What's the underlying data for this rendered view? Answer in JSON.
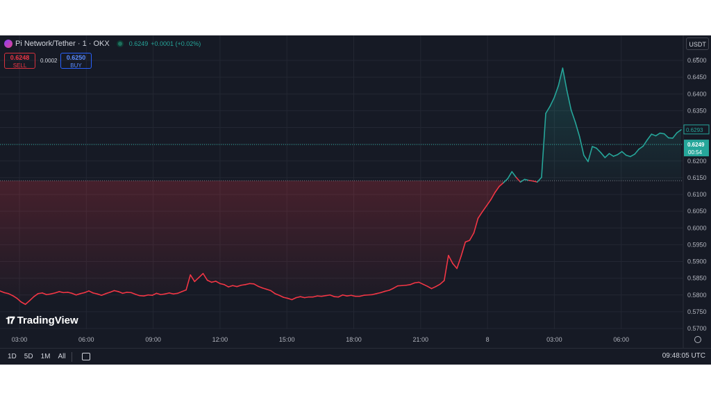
{
  "header": {
    "symbol": "Pi Network/Tether · 1 · OKX",
    "last": "0.6249",
    "change": "+0.0001 (+0.02%)"
  },
  "orders": {
    "sell_price": "0.6248",
    "sell_label": "SELL",
    "spread": "0.0002",
    "buy_price": "0.6250",
    "buy_label": "BUY"
  },
  "currency": "USDT",
  "logo": "TradingView",
  "ranges": [
    "1D",
    "5D",
    "1M",
    "All"
  ],
  "clock": "09:48:05 UTC",
  "price_labels": {
    "current": "0.6249",
    "countdown": "00:54",
    "reference": "0.6293"
  },
  "colors": {
    "up": "#26a69a",
    "down": "#f23645",
    "background": "#161a25"
  },
  "chart_data": {
    "type": "line",
    "title": "Pi Network/Tether · 1 · OKX",
    "x_ticks": [
      "03:00",
      "06:00",
      "09:00",
      "12:00",
      "15:00",
      "18:00",
      "21:00",
      "8",
      "03:00",
      "06:00"
    ],
    "y_ticks": [
      "0.6500",
      "0.6450",
      "0.6400",
      "0.6350",
      "0.6300",
      "0.6250",
      "0.6200",
      "0.6150",
      "0.6100",
      "0.6050",
      "0.6000",
      "0.5950",
      "0.5900",
      "0.5850",
      "0.5800",
      "0.5750",
      "0.5700"
    ],
    "ylim": [
      0.569,
      0.651
    ],
    "baseline": 0.6141,
    "x_hours_per_step": 0.25,
    "series": [
      {
        "values": [
          0.5812,
          0.5807,
          0.5804,
          0.5798,
          0.579,
          0.5779,
          0.5772,
          0.5783,
          0.5795,
          0.5804,
          0.5806,
          0.5801,
          0.5803,
          0.5806,
          0.581,
          0.5807,
          0.5808,
          0.5805,
          0.58,
          0.5804,
          0.5807,
          0.5812,
          0.5806,
          0.5803,
          0.5799,
          0.5804,
          0.5808,
          0.5813,
          0.581,
          0.5805,
          0.5808,
          0.5807,
          0.5802,
          0.5798,
          0.5797,
          0.58,
          0.5799,
          0.5805,
          0.5801,
          0.5803,
          0.5806,
          0.5803,
          0.5805,
          0.581,
          0.5815,
          0.586,
          0.584,
          0.5852,
          0.5864,
          0.5844,
          0.5838,
          0.5841,
          0.5834,
          0.5831,
          0.5824,
          0.5828,
          0.5825,
          0.5829,
          0.5831,
          0.5834,
          0.5833,
          0.5826,
          0.5821,
          0.5817,
          0.5813,
          0.5804,
          0.5799,
          0.5793,
          0.579,
          0.5786,
          0.5792,
          0.5795,
          0.5792,
          0.5794,
          0.5794,
          0.5797,
          0.5796,
          0.5798,
          0.58,
          0.5795,
          0.5794,
          0.58,
          0.5797,
          0.5799,
          0.5796,
          0.5796,
          0.5799,
          0.58,
          0.5801,
          0.5804,
          0.5807,
          0.5811,
          0.5814,
          0.582,
          0.5827,
          0.5828,
          0.5829,
          0.5831,
          0.5836,
          0.5838,
          0.5832,
          0.5826,
          0.5819,
          0.5825,
          0.5832,
          0.5843,
          0.5918,
          0.5894,
          0.5879,
          0.5916,
          0.5958,
          0.5963,
          0.5985,
          0.6029,
          0.6048,
          0.6066,
          0.6084,
          0.6106,
          0.6124,
          0.6135,
          0.6147,
          0.6168,
          0.6151,
          0.6137,
          0.6145,
          0.6142,
          0.614,
          0.6137,
          0.6151,
          0.6342,
          0.6363,
          0.6389,
          0.6425,
          0.6477,
          0.641,
          0.6352,
          0.6315,
          0.6272,
          0.6217,
          0.6198,
          0.6243,
          0.6238,
          0.6225,
          0.621,
          0.6222,
          0.6214,
          0.6219,
          0.6228,
          0.6217,
          0.6213,
          0.622,
          0.6235,
          0.6244,
          0.6263,
          0.628,
          0.6275,
          0.6283,
          0.6281,
          0.6269,
          0.6268,
          0.6284,
          0.6293
        ]
      }
    ]
  }
}
